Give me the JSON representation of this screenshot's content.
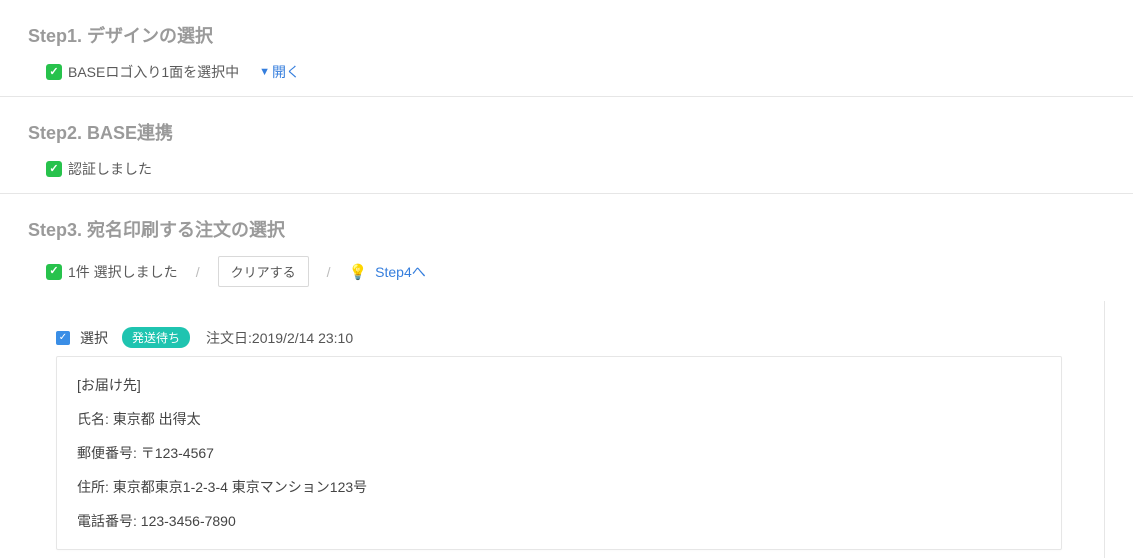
{
  "step1": {
    "title": "Step1. デザインの選択",
    "status": "BASEロゴ入り1面を選択中",
    "open_label": "開く"
  },
  "step2": {
    "title": "Step2. BASE連携",
    "status": "認証しました"
  },
  "step3": {
    "title": "Step3. 宛名印刷する注文の選択",
    "status": "1件 選択しました",
    "clear_label": "クリアする",
    "step4_link": "Step4へ"
  },
  "order": {
    "select_label": "選択",
    "badge": "発送待ち",
    "date_label": "注文日:",
    "date_value": "2019/2/14 23:10",
    "delivery_header": "[お届け先]",
    "name_label": "氏名:",
    "name_value": "東京都 出得太",
    "postal_label": "郵便番号:",
    "postal_value": "〒123-4567",
    "address_label": "住所:",
    "address_value": "東京都東京1-2-3-4 東京マンション123号",
    "phone_label": "電話番号:",
    "phone_value": "123-3456-7890"
  }
}
